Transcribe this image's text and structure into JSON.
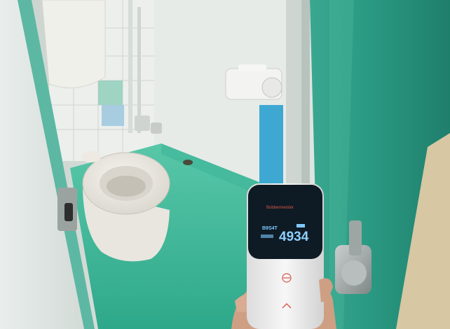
{
  "scene": {
    "kind": "photo",
    "subject": "restroom-stall-with-handheld-meter"
  },
  "meter": {
    "brand": "Bobbermeister",
    "model_label": "B9S4T",
    "reading": "4934",
    "icons": [
      "power-icon",
      "chevron-up-icon"
    ]
  },
  "colors": {
    "floor": "#3fb89a",
    "door": "#2f9c86",
    "wall": "#dfe6e2",
    "meter_screen": "#0e1a24",
    "meter_body": "#f1f1f1"
  }
}
